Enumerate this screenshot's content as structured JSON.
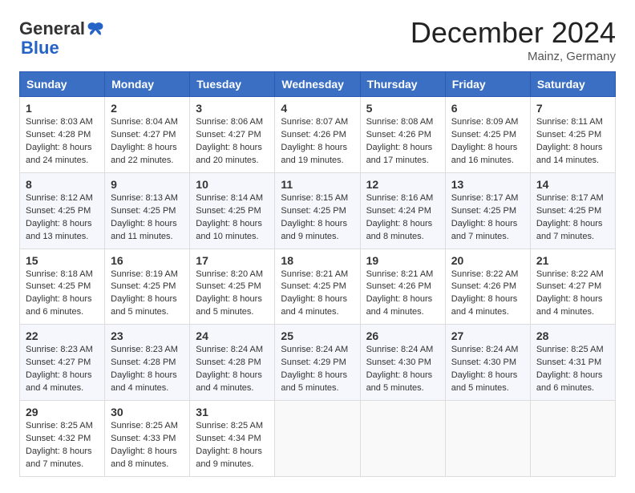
{
  "header": {
    "logo_general": "General",
    "logo_blue": "Blue",
    "month_title": "December 2024",
    "location": "Mainz, Germany"
  },
  "calendar": {
    "days_of_week": [
      "Sunday",
      "Monday",
      "Tuesday",
      "Wednesday",
      "Thursday",
      "Friday",
      "Saturday"
    ],
    "weeks": [
      [
        {
          "day": "1",
          "sunrise": "8:03 AM",
          "sunset": "4:28 PM",
          "daylight": "8 hours and 24 minutes."
        },
        {
          "day": "2",
          "sunrise": "8:04 AM",
          "sunset": "4:27 PM",
          "daylight": "8 hours and 22 minutes."
        },
        {
          "day": "3",
          "sunrise": "8:06 AM",
          "sunset": "4:27 PM",
          "daylight": "8 hours and 20 minutes."
        },
        {
          "day": "4",
          "sunrise": "8:07 AM",
          "sunset": "4:26 PM",
          "daylight": "8 hours and 19 minutes."
        },
        {
          "day": "5",
          "sunrise": "8:08 AM",
          "sunset": "4:26 PM",
          "daylight": "8 hours and 17 minutes."
        },
        {
          "day": "6",
          "sunrise": "8:09 AM",
          "sunset": "4:25 PM",
          "daylight": "8 hours and 16 minutes."
        },
        {
          "day": "7",
          "sunrise": "8:11 AM",
          "sunset": "4:25 PM",
          "daylight": "8 hours and 14 minutes."
        }
      ],
      [
        {
          "day": "8",
          "sunrise": "8:12 AM",
          "sunset": "4:25 PM",
          "daylight": "8 hours and 13 minutes."
        },
        {
          "day": "9",
          "sunrise": "8:13 AM",
          "sunset": "4:25 PM",
          "daylight": "8 hours and 11 minutes."
        },
        {
          "day": "10",
          "sunrise": "8:14 AM",
          "sunset": "4:25 PM",
          "daylight": "8 hours and 10 minutes."
        },
        {
          "day": "11",
          "sunrise": "8:15 AM",
          "sunset": "4:25 PM",
          "daylight": "8 hours and 9 minutes."
        },
        {
          "day": "12",
          "sunrise": "8:16 AM",
          "sunset": "4:24 PM",
          "daylight": "8 hours and 8 minutes."
        },
        {
          "day": "13",
          "sunrise": "8:17 AM",
          "sunset": "4:25 PM",
          "daylight": "8 hours and 7 minutes."
        },
        {
          "day": "14",
          "sunrise": "8:17 AM",
          "sunset": "4:25 PM",
          "daylight": "8 hours and 7 minutes."
        }
      ],
      [
        {
          "day": "15",
          "sunrise": "8:18 AM",
          "sunset": "4:25 PM",
          "daylight": "8 hours and 6 minutes."
        },
        {
          "day": "16",
          "sunrise": "8:19 AM",
          "sunset": "4:25 PM",
          "daylight": "8 hours and 5 minutes."
        },
        {
          "day": "17",
          "sunrise": "8:20 AM",
          "sunset": "4:25 PM",
          "daylight": "8 hours and 5 minutes."
        },
        {
          "day": "18",
          "sunrise": "8:21 AM",
          "sunset": "4:25 PM",
          "daylight": "8 hours and 4 minutes."
        },
        {
          "day": "19",
          "sunrise": "8:21 AM",
          "sunset": "4:26 PM",
          "daylight": "8 hours and 4 minutes."
        },
        {
          "day": "20",
          "sunrise": "8:22 AM",
          "sunset": "4:26 PM",
          "daylight": "8 hours and 4 minutes."
        },
        {
          "day": "21",
          "sunrise": "8:22 AM",
          "sunset": "4:27 PM",
          "daylight": "8 hours and 4 minutes."
        }
      ],
      [
        {
          "day": "22",
          "sunrise": "8:23 AM",
          "sunset": "4:27 PM",
          "daylight": "8 hours and 4 minutes."
        },
        {
          "day": "23",
          "sunrise": "8:23 AM",
          "sunset": "4:28 PM",
          "daylight": "8 hours and 4 minutes."
        },
        {
          "day": "24",
          "sunrise": "8:24 AM",
          "sunset": "4:28 PM",
          "daylight": "8 hours and 4 minutes."
        },
        {
          "day": "25",
          "sunrise": "8:24 AM",
          "sunset": "4:29 PM",
          "daylight": "8 hours and 5 minutes."
        },
        {
          "day": "26",
          "sunrise": "8:24 AM",
          "sunset": "4:30 PM",
          "daylight": "8 hours and 5 minutes."
        },
        {
          "day": "27",
          "sunrise": "8:24 AM",
          "sunset": "4:30 PM",
          "daylight": "8 hours and 5 minutes."
        },
        {
          "day": "28",
          "sunrise": "8:25 AM",
          "sunset": "4:31 PM",
          "daylight": "8 hours and 6 minutes."
        }
      ],
      [
        {
          "day": "29",
          "sunrise": "8:25 AM",
          "sunset": "4:32 PM",
          "daylight": "8 hours and 7 minutes."
        },
        {
          "day": "30",
          "sunrise": "8:25 AM",
          "sunset": "4:33 PM",
          "daylight": "8 hours and 8 minutes."
        },
        {
          "day": "31",
          "sunrise": "8:25 AM",
          "sunset": "4:34 PM",
          "daylight": "8 hours and 9 minutes."
        },
        null,
        null,
        null,
        null
      ]
    ],
    "labels": {
      "sunrise": "Sunrise:",
      "sunset": "Sunset:",
      "daylight": "Daylight:"
    }
  }
}
